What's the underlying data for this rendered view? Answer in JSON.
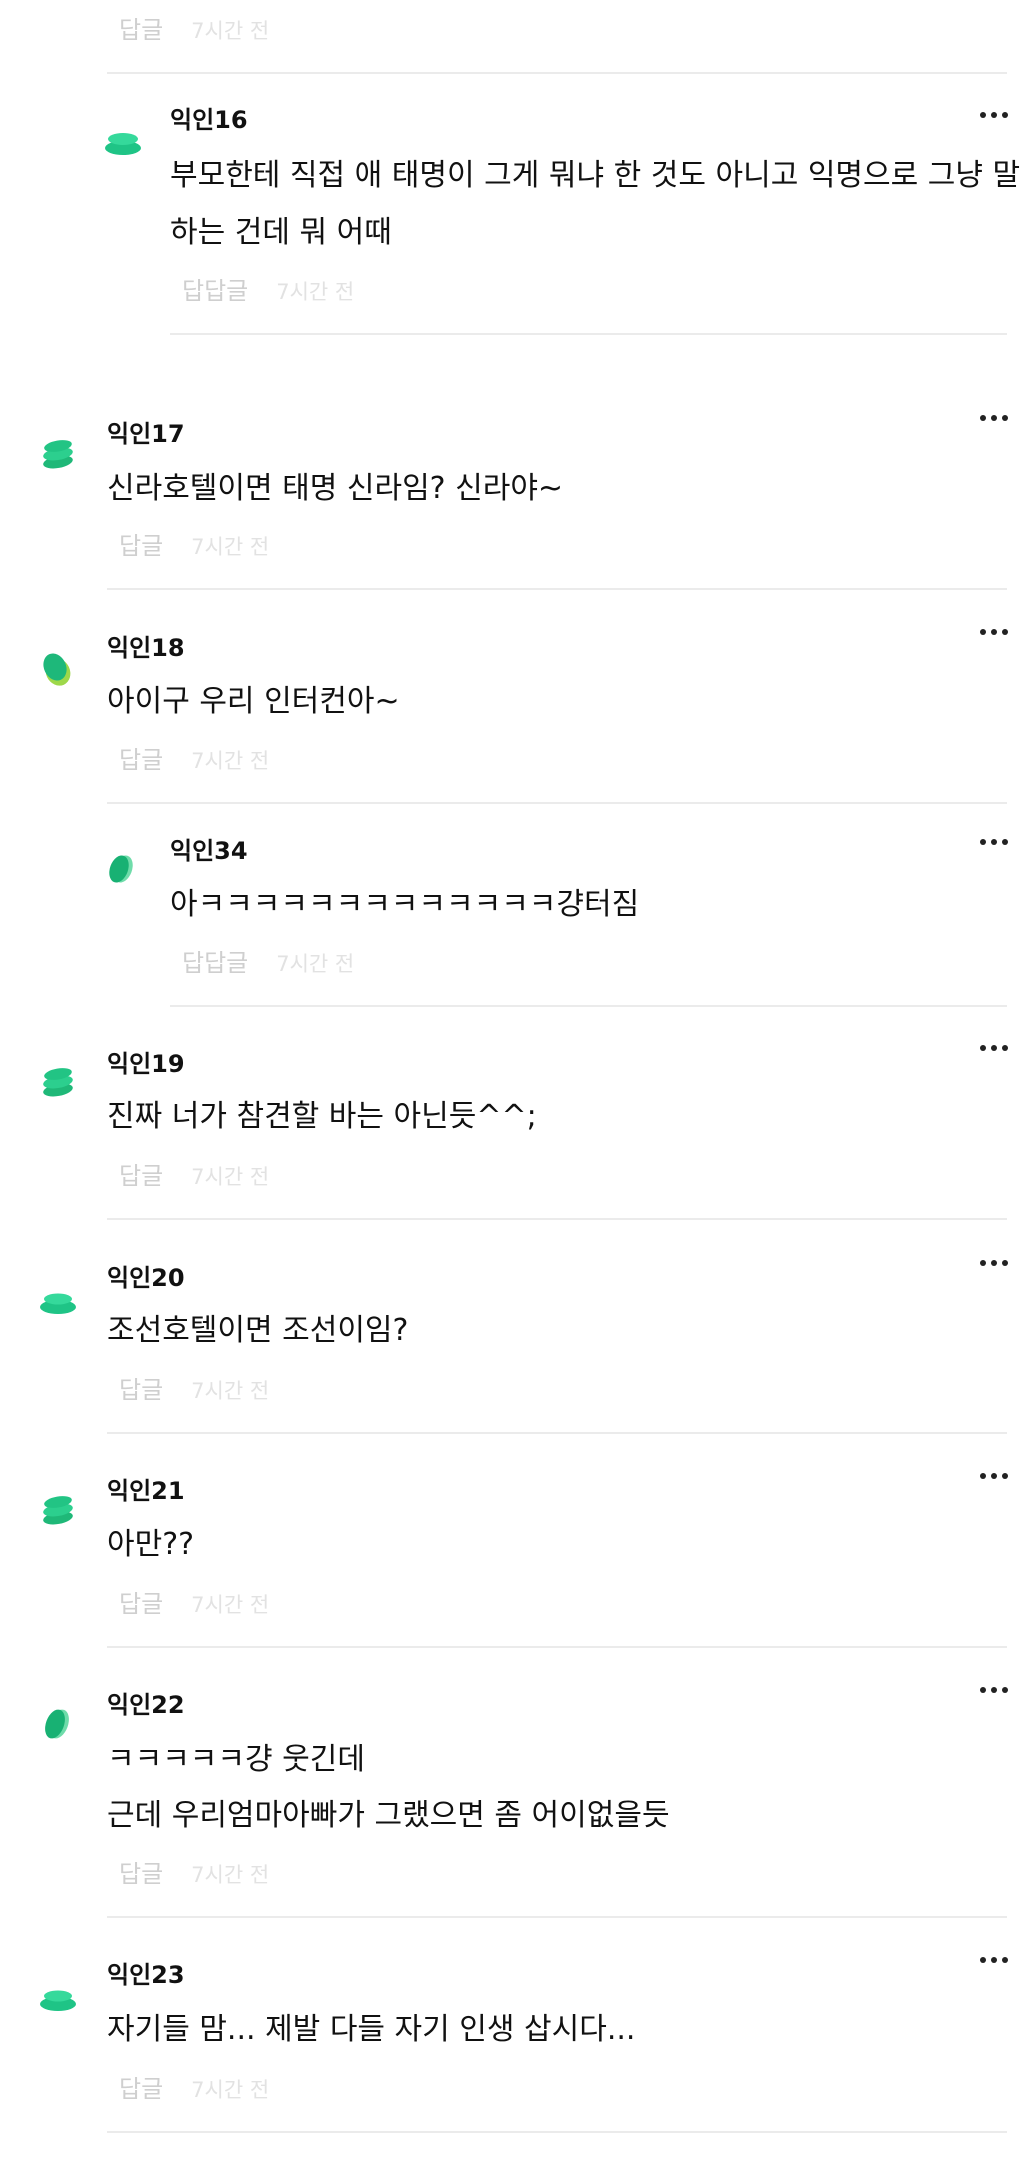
{
  "top_partial": {
    "reply_label": "답글",
    "time": "7시간 전"
  },
  "comments": [
    {
      "author": "익인16",
      "lines": [
        "부모한테 직접 애 태명이 그게 뭐냐 한 것도 아니고 익명으로 그냥 말",
        "하는 건데 뭐 어때"
      ],
      "reply_label": "답답글",
      "time": "7시간 전",
      "avatar": "avatar-discs-icon"
    },
    {
      "author": "익인17",
      "lines": [
        "신라호텔이면 태명 신라임? 신라야~"
      ],
      "reply_label": "답글",
      "time": "7시간 전",
      "avatar": "avatar-stack-icon"
    },
    {
      "author": "익인18",
      "lines": [
        "아이구 우리 인터컨아~"
      ],
      "reply_label": "답글",
      "time": "7시간 전",
      "avatar": "avatar-leaf-icon"
    },
    {
      "author": "익인34",
      "lines": [
        "아ㅋㅋㅋㅋㅋㅋㅋㅋㅋㅋㅋㅋㅋ걍터짐"
      ],
      "reply_label": "답답글",
      "time": "7시간 전",
      "avatar": "avatar-leaf-icon"
    },
    {
      "author": "익인19",
      "lines": [
        "진짜 너가 참견할 바는 아닌듯^^;"
      ],
      "reply_label": "답글",
      "time": "7시간 전",
      "avatar": "avatar-stack-icon"
    },
    {
      "author": "익인20",
      "lines": [
        "조선호텔이면 조선이임?"
      ],
      "reply_label": "답글",
      "time": "7시간 전",
      "avatar": "avatar-discs-icon"
    },
    {
      "author": "익인21",
      "lines": [
        "아만??"
      ],
      "reply_label": "답글",
      "time": "7시간 전",
      "avatar": "avatar-stack-icon"
    },
    {
      "author": "익인22",
      "lines": [
        "ㅋㅋㅋㅋㅋ걍 웃긴데",
        "근데 우리엄마아빠가 그랬으면 좀 어이없을듯"
      ],
      "reply_label": "답글",
      "time": "7시간 전",
      "avatar": "avatar-leaf-icon"
    },
    {
      "author": "익인23",
      "lines": [
        "자기들 맘... 제발 다들 자기 인생 삽시다..."
      ],
      "reply_label": "답글",
      "time": "7시간 전",
      "avatar": "avatar-discs-icon"
    }
  ],
  "colors": {
    "accent": "#2ad08f",
    "accent_dark": "#1aa874",
    "accent_lime": "#9ed84a",
    "divider": "#ebebeb"
  }
}
